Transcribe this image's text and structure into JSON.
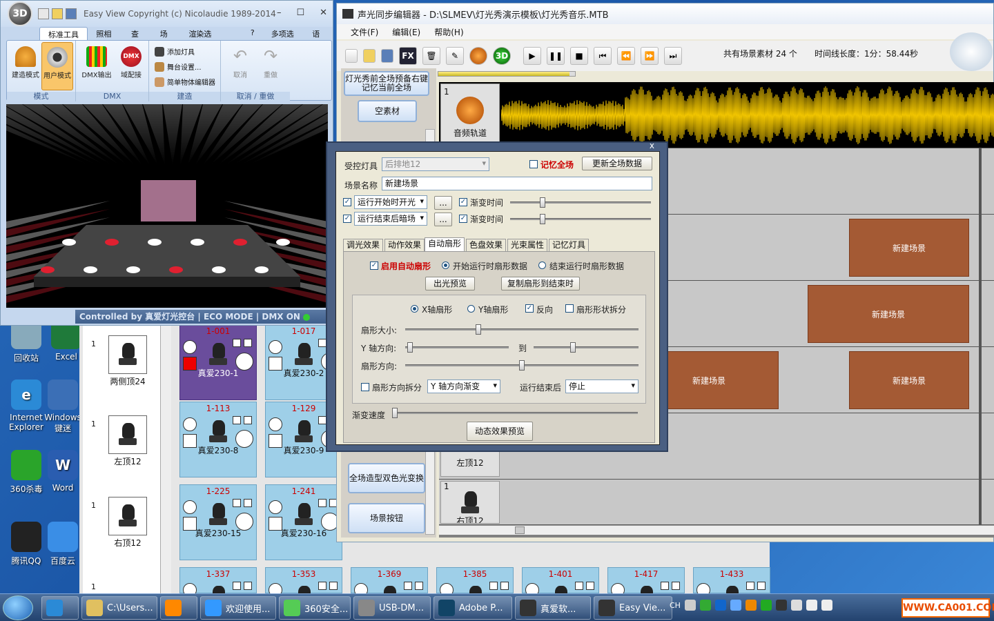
{
  "desktop": {
    "icons": [
      {
        "label": "回收站"
      },
      {
        "label": "Excel"
      },
      {
        "label": "Internet Explorer"
      },
      {
        "label": "Windows 键迷"
      },
      {
        "label": "360杀毒"
      },
      {
        "label": "Word"
      },
      {
        "label": "腾讯QQ"
      },
      {
        "label": "百度云"
      }
    ]
  },
  "easyview": {
    "logo": "3D",
    "title": "Easy View   Copyright (c) Nicolaudie 1989-2014",
    "tabs": [
      "标准工具栏",
      "照相机",
      "查看",
      "场景",
      "渲染选项"
    ],
    "tabs_right": [
      "?",
      "多项选择",
      "语言"
    ],
    "groups": [
      {
        "label": "模式"
      },
      {
        "label": "DMX"
      },
      {
        "label": "建造"
      },
      {
        "label": "取消 / 重做"
      }
    ],
    "buttons": {
      "build_mode": "建造模式",
      "user_mode": "用户模式",
      "dmx_out": "DMX输出",
      "domain": "域配接",
      "dmx_badge": "DMX",
      "add_lamp": "添加灯具",
      "stage_setup": "舞台设置...",
      "simple_obj": "简单物体编辑器",
      "undo": "取消",
      "redo": "重做"
    },
    "status": "Controlled by 真爱灯光控台  |  ECO MODE  |  DMX ON"
  },
  "fixtures": {
    "list": [
      {
        "num": "1",
        "name": "两侧顶24"
      },
      {
        "num": "1",
        "name": "左顶12"
      },
      {
        "num": "1",
        "name": "右顶12"
      },
      {
        "num": "1",
        "name": ""
      }
    ],
    "tiles": [
      {
        "num": "1-001",
        "name": "真爱230-1",
        "sel": true
      },
      {
        "num": "1-017",
        "name": "真爱230-2"
      },
      {
        "num": "1-113",
        "name": "真爱230-8"
      },
      {
        "num": "1-129",
        "name": "真爱230-9"
      },
      {
        "num": "1-225",
        "name": "真爱230-15"
      },
      {
        "num": "1-241",
        "name": "真爱230-16"
      },
      {
        "num": "1-337",
        "name": ""
      },
      {
        "num": "1-353",
        "name": ""
      },
      {
        "num": "1-369",
        "name": ""
      },
      {
        "num": "1-385",
        "name": ""
      },
      {
        "num": "1-401",
        "name": ""
      },
      {
        "num": "1-417",
        "name": ""
      },
      {
        "num": "1-433",
        "name": ""
      }
    ]
  },
  "editor": {
    "title": "声光同步编辑器 - D:\\SLMEV\\灯光秀演示模板\\灯光秀音乐.MTB",
    "menu": [
      "文件(F)",
      "编辑(E)",
      "帮助(H)"
    ],
    "toolbar_labels": {
      "fx": "FX",
      "b3d": "3D"
    },
    "info_count": "共有场景素材 24 个",
    "info_length": "时间线长度：1分：58.44秒",
    "left_buttons": [
      "灯光秀前全场预备右键记忆当前全场",
      "空素材",
      "全场造型双色光变换",
      "场景按钮"
    ],
    "audio_track": {
      "num": "1",
      "label": "音频轨道"
    },
    "tracks": [
      {
        "num": "",
        "label": "左顶12"
      },
      {
        "num": "1",
        "label": "右顶12"
      }
    ],
    "scene_label": "新建场景"
  },
  "dialog": {
    "close": "x",
    "controlled_lamp_label": "受控灯具",
    "controlled_lamp_value": "后排地12",
    "remember_all": "记忆全场",
    "update_all": "更新全场数据",
    "scene_name_label": "场景名称",
    "scene_name_value": "新建场景",
    "start_action": "运行开始时开光",
    "end_action": "运行结束后暗场",
    "dots": "...",
    "fade_time": "渐变时间",
    "tabs": [
      "调光效果",
      "动作效果",
      "自动扇形",
      "色盘效果",
      "光束属性",
      "记忆灯具"
    ],
    "active_tab": 2,
    "auto_fan": "启用自动扇形",
    "start_fan": "开始运行时扇形数据",
    "end_fan": "结束运行时扇形数据",
    "preview_light": "出光预览",
    "copy_fan": "复制扇形到结束时",
    "x_fan": "X轴扇形",
    "y_fan": "Y轴扇形",
    "reverse": "反向",
    "split_shape": "扇形形状拆分",
    "fan_size": "扇形大小:",
    "y_dir": "Y 轴方向:",
    "to": "到",
    "fan_dir": "扇形方向:",
    "dir_split": "扇形方向拆分",
    "dir_split_value": "Y 轴方向渐变",
    "after_end": "运行结束后",
    "after_end_value": "停止",
    "fade_speed": "渐变速度",
    "dynamic_preview": "动态效果预览",
    "sliders": {
      "fade1": 0.22,
      "fade2": 0.22,
      "fan_size": 0.31,
      "y_from": 0.02,
      "y_to": 0.37,
      "fan_dir": 0.5,
      "speed": 0.0
    }
  },
  "taskbar": {
    "items": [
      "",
      "",
      "C:\\Users...",
      "",
      "欢迎使用...",
      "360安全...",
      "USB-DM...",
      "Adobe P...",
      "真爱软...",
      "Easy Vie..."
    ],
    "tray_text": "CH",
    "watermark": "WWW.CA001.COM"
  },
  "colors": {
    "scene": "#a45a34",
    "wave": "#f0c400",
    "accent": "#c00000"
  }
}
